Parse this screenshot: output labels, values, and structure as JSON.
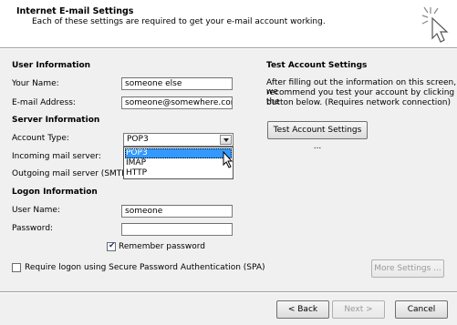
{
  "header": {
    "title": "Internet E-mail Settings",
    "subtitle": "Each of these settings are required to get your e-mail account working."
  },
  "user_info": {
    "heading": "User Information",
    "name_label": "Your Name:",
    "name_value": "someone else",
    "email_label": "E-mail Address:",
    "email_value": "someone@somewhere.com"
  },
  "server_info": {
    "heading": "Server Information",
    "account_type_label": "Account Type:",
    "account_type_value": "POP3",
    "account_type_options": [
      "POP3",
      "IMAP",
      "HTTP"
    ],
    "incoming_label": "Incoming mail server:",
    "outgoing_label": "Outgoing mail server (SMTP):"
  },
  "logon_info": {
    "heading": "Logon Information",
    "user_label": "User Name:",
    "user_value": "someone",
    "password_label": "Password:",
    "password_value": "",
    "remember_label": "Remember password",
    "remember_checked": true,
    "spa_label": "Require logon using Secure Password Authentication (SPA)",
    "spa_checked": false
  },
  "test_settings": {
    "heading": "Test Account Settings",
    "description_1": "After filling out the information on this screen, we",
    "description_2": "recommend you test your account by clicking the",
    "description_3": "button below. (Requires network connection)",
    "button_label": "Test Account Settings ..."
  },
  "more_settings_label": "More Settings ...",
  "footer": {
    "back_label": "< Back",
    "next_label": "Next >",
    "cancel_label": "Cancel"
  }
}
